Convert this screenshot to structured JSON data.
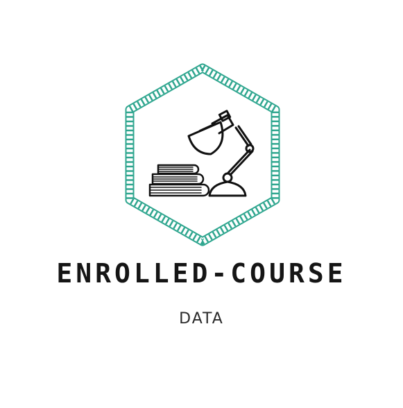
{
  "logo": {
    "title": "ENROLLED-COURSE",
    "subtitle": "DATA",
    "emblem_icon": "desk-lamp-and-books-icon",
    "frame": "rope-hexagon",
    "colors": {
      "rope": "#2fa68f",
      "text": "#151515",
      "background": "#ffffff"
    }
  }
}
